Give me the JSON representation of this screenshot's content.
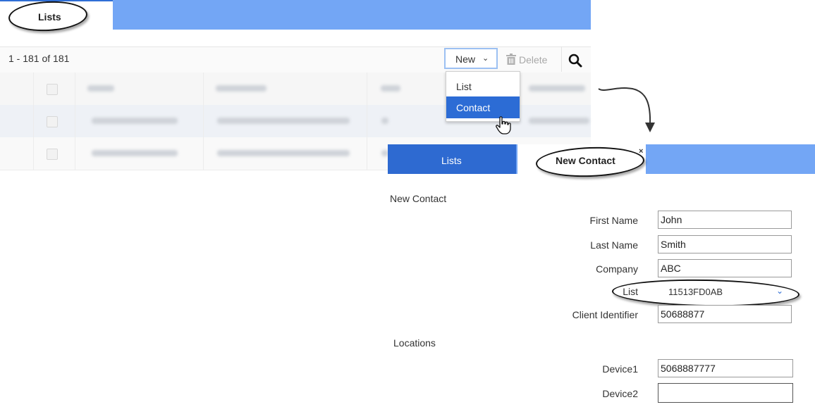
{
  "top_panel": {
    "tab_label": "Lists",
    "range_text": "1 - 181 of 181",
    "toolbar": {
      "new_label": "New",
      "new_icon": "chevron-down-icon",
      "delete_label": "Delete",
      "delete_icon": "trash-icon",
      "search_icon": "search-icon"
    },
    "dropdown": {
      "items": [
        "List",
        "Contact"
      ],
      "selected": "Contact"
    },
    "grid_note": "blurred table rows"
  },
  "bottom_panel": {
    "tabs": [
      {
        "label": "Lists"
      },
      {
        "label": "New Contact",
        "close_icon": "×"
      }
    ],
    "section_title": "New Contact",
    "fields": {
      "first_name": {
        "label": "First Name",
        "value": "John"
      },
      "last_name": {
        "label": "Last Name",
        "value": "Smith"
      },
      "company": {
        "label": "Company",
        "value": "ABC"
      },
      "list": {
        "label": "List",
        "value": "11513FD0AB"
      },
      "client_identifier": {
        "label": "Client Identifier",
        "value": "50688877"
      }
    },
    "locations_title": "Locations",
    "devices": {
      "device1": {
        "label": "Device1",
        "value": "5068887777"
      },
      "device2": {
        "label": "Device2",
        "value": ""
      }
    }
  },
  "colors": {
    "tab_bar": "#73a6f5",
    "accent": "#2c6cd5",
    "active_tab_dark": "#2e6ad1"
  }
}
